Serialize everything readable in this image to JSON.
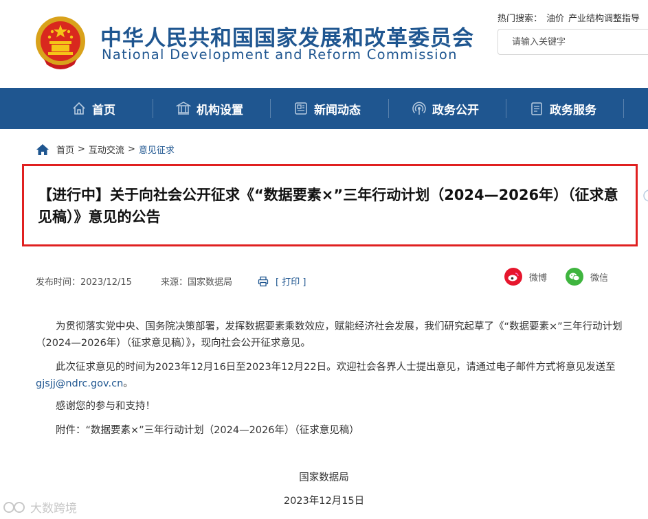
{
  "site": {
    "title_cn": "中华人民共和国国家发展和改革委员会",
    "title_en": "National Development and Reform Commission"
  },
  "search": {
    "hot_label": "热门搜索：",
    "hot_links": [
      "油价",
      "产业结构调整指导"
    ],
    "placeholder": "请输入关键字"
  },
  "nav": {
    "items": [
      {
        "label": "首页",
        "icon": "home-icon"
      },
      {
        "label": "机构设置",
        "icon": "building-icon"
      },
      {
        "label": "新闻动态",
        "icon": "news-icon"
      },
      {
        "label": "政务公开",
        "icon": "broadcast-icon"
      },
      {
        "label": "政务服务",
        "icon": "document-icon"
      }
    ]
  },
  "breadcrumb": {
    "items": [
      "首页",
      "互动交流",
      "意见征求"
    ],
    "separator": ">"
  },
  "article": {
    "title": "【进行中】关于向社会公开征求《“数据要素×”三年行动计划（2024—2026年）（征求意见稿）》意见的公告",
    "publish_label": "发布时间：",
    "publish_date": "2023/12/15",
    "source_label": "来源：",
    "source": "国家数据局",
    "print_label": "[ 打印 ]",
    "share": [
      {
        "label": "微博",
        "icon": "weibo-icon",
        "color": "#e6162d"
      },
      {
        "label": "微信",
        "icon": "wechat-icon",
        "color": "#3fb53f"
      }
    ],
    "para1": "为贯彻落实党中央、国务院决策部署，发挥数据要素乘数效应，赋能经济社会发展，我们研究起草了《“数据要素×”三年行动计划（2024—2026年）（征求意见稿）》，现向社会公开征求意见。",
    "para2_text": "此次征求意见的时间为2023年12月16日至2023年12月22日。欢迎社会各界人士提出意见，请通过电子邮件方式将意见发送至",
    "para2_email": "gjsjj@ndrc.gov.cn",
    "para2_end": "。",
    "para3": "感谢您的参与和支持！",
    "attachment": "附件：“数据要素×”三年行动计划（2024—2026年）（征求意见稿）",
    "signature_org": "国家数据局",
    "signature_date": "2023年12月15日"
  },
  "watermark": "大数跨境",
  "colors": {
    "brand_blue": "#1f5690",
    "highlight_red": "#e02020"
  }
}
